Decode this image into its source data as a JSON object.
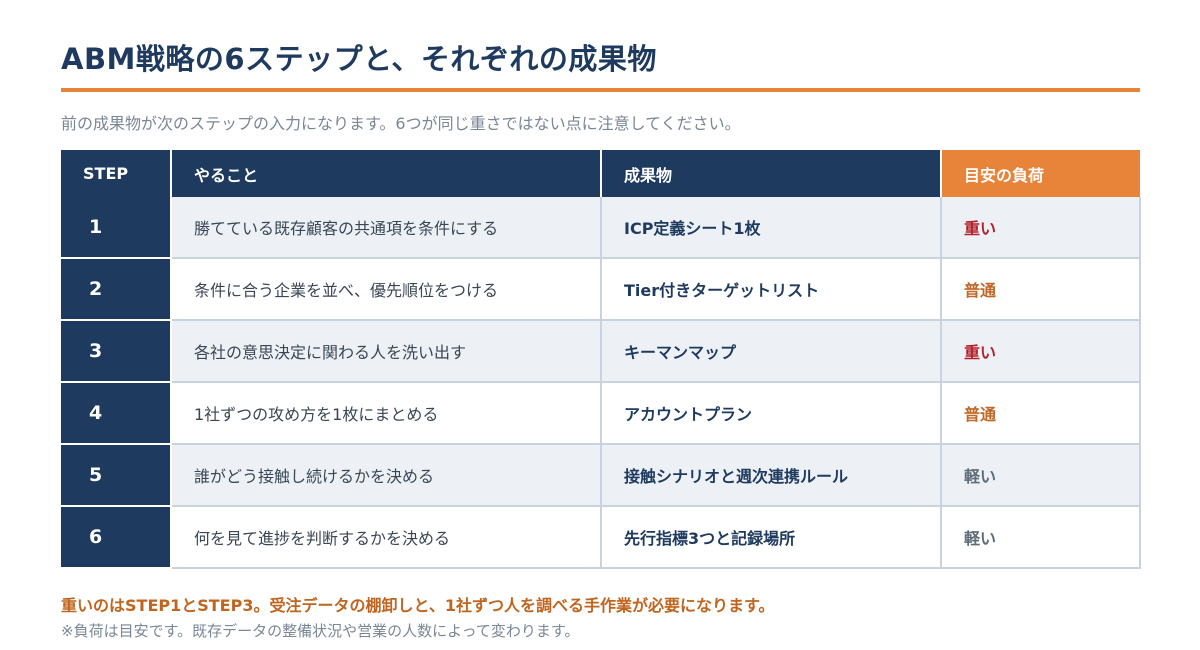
{
  "title": "ABM戦略の6ステップと、それぞれの成果物",
  "subtitle": "前の成果物が次のステップの入力になります。6つが同じ重さではない点に注意してください。",
  "table": {
    "headers": {
      "step": "STEP",
      "task": "やること",
      "output": "成果物",
      "load": "目安の負荷"
    },
    "rows": [
      {
        "step": "1",
        "task": "勝てている既存顧客の共通項を条件にする",
        "output": "ICP定義シート1枚",
        "load": "重い",
        "level": "heavy"
      },
      {
        "step": "2",
        "task": "条件に合う企業を並べ、優先順位をつける",
        "output": "Tier付きターゲットリスト",
        "load": "普通",
        "level": "normal"
      },
      {
        "step": "3",
        "task": "各社の意思決定に関わる人を洗い出す",
        "output": "キーマンマップ",
        "load": "重い",
        "level": "heavy"
      },
      {
        "step": "4",
        "task": "1社ずつの攻め方を1枚にまとめる",
        "output": "アカウントプラン",
        "load": "普通",
        "level": "normal"
      },
      {
        "step": "5",
        "task": "誰がどう接触し続けるかを決める",
        "output": "接触シナリオと週次連携ルール",
        "load": "軽い",
        "level": "light"
      },
      {
        "step": "6",
        "task": "何を見て進捗を判断するかを決める",
        "output": "先行指標3つと記録場所",
        "load": "軽い",
        "level": "light"
      }
    ]
  },
  "colors": {
    "navy": "#1e3a5f",
    "accent_orange": "#e8843a",
    "heavy": "#b3202a",
    "normal": "#c0682a",
    "light": "#5f6b78"
  },
  "notes": {
    "emphasis": "重いのはSTEP1とSTEP3。受注データの棚卸しと、1社ずつ人を調べる手作業が必要になります。",
    "footnote": "※負荷は目安です。既存データの整備状況や営業の人数によって変わります。"
  }
}
